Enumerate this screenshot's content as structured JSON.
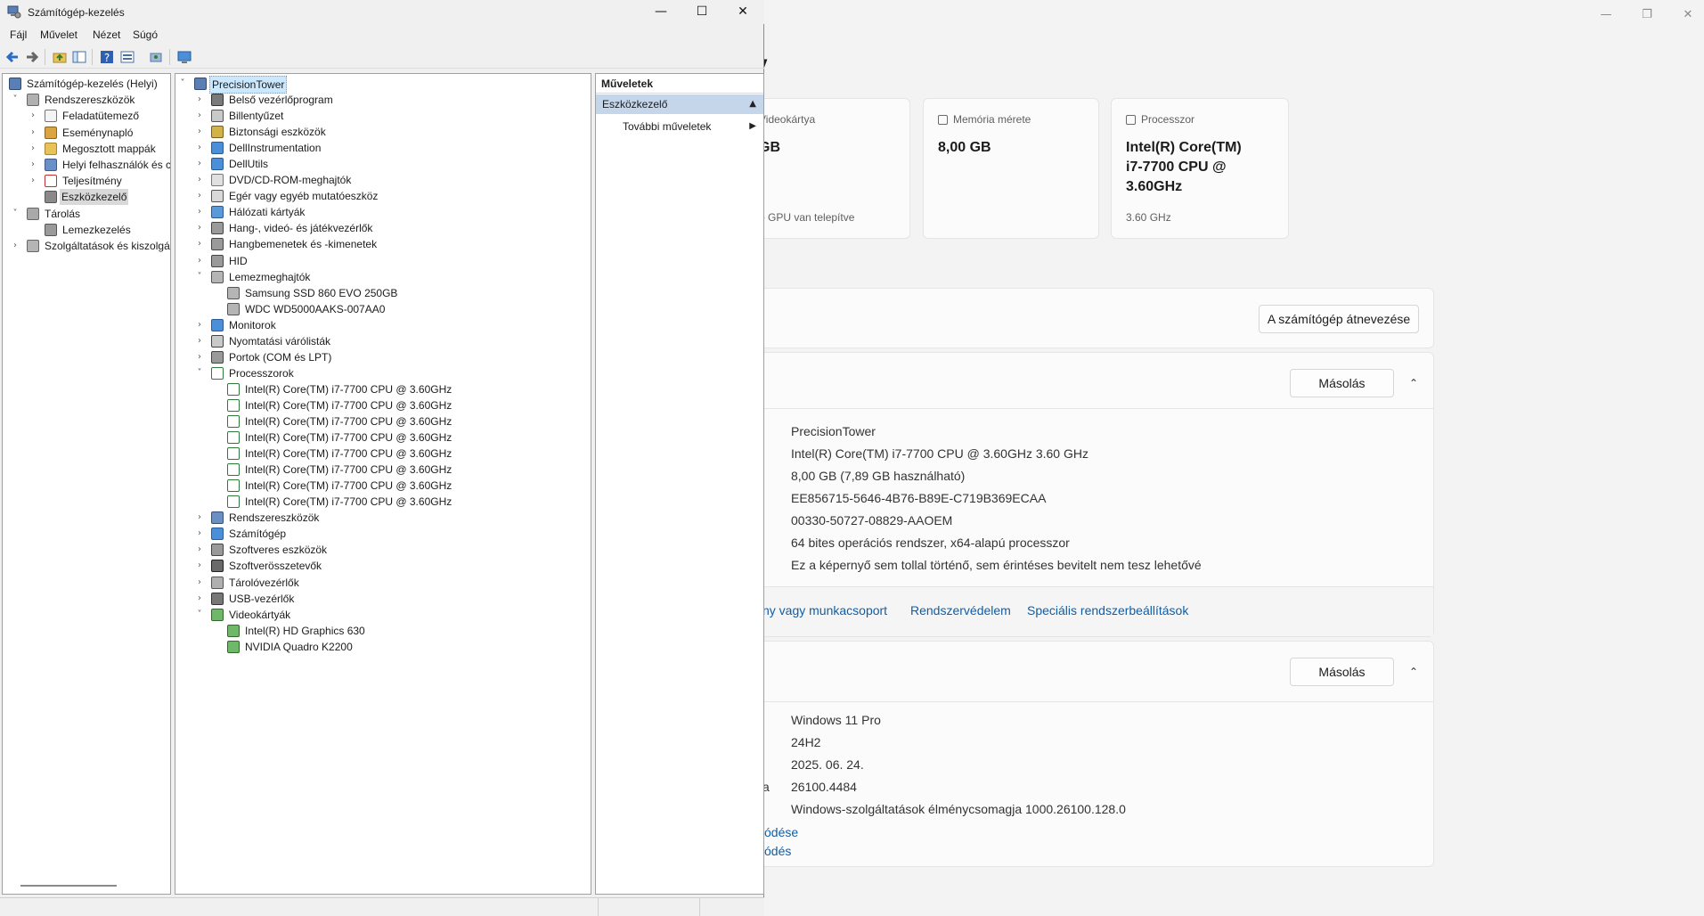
{
  "mmc": {
    "title": "Számítógép-kezelés",
    "window_controls": {
      "minimize": "—",
      "maximize": "☐",
      "close": "✕"
    },
    "menu": [
      "Fájl",
      "Művelet",
      "Nézet",
      "Súgó"
    ],
    "left_tree": [
      {
        "label": "Számítógép-kezelés (Helyi)",
        "icon": "computer-management-icon",
        "expander": ""
      },
      {
        "label": "Rendszereszközök",
        "icon": "tools-icon",
        "expander": "˅"
      },
      {
        "label": "Feladatütemező",
        "icon": "clock-icon",
        "expander": "›"
      },
      {
        "label": "Eseménynapló",
        "icon": "event-log-icon",
        "expander": "›"
      },
      {
        "label": "Megosztott mappák",
        "icon": "shared-folder-icon",
        "expander": "›"
      },
      {
        "label": "Helyi felhasználók és cs",
        "icon": "users-icon",
        "expander": "›"
      },
      {
        "label": "Teljesítmény",
        "icon": "performance-icon",
        "expander": "›"
      },
      {
        "label": "Eszközkezelő",
        "icon": "device-manager-icon",
        "expander": ""
      },
      {
        "label": "Tárolás",
        "icon": "storage-icon",
        "expander": "˅"
      },
      {
        "label": "Lemezkezelés",
        "icon": "disk-management-icon",
        "expander": ""
      },
      {
        "label": "Szolgáltatások és kiszolgáló",
        "icon": "services-icon",
        "expander": "›"
      }
    ],
    "device_tree": {
      "root": "PrecisionTower",
      "items": [
        {
          "label": "Belső vezérlőprogram",
          "icon": "firmware-icon",
          "expander": "›",
          "level": 1
        },
        {
          "label": "Billentyűzet",
          "icon": "keyboard-icon",
          "expander": "›",
          "level": 1
        },
        {
          "label": "Biztonsági eszközök",
          "icon": "security-device-icon",
          "expander": "›",
          "level": 1
        },
        {
          "label": "DellInstrumentation",
          "icon": "monitor-icon",
          "expander": "›",
          "level": 1
        },
        {
          "label": "DellUtils",
          "icon": "monitor-icon",
          "expander": "›",
          "level": 1
        },
        {
          "label": "DVD/CD-ROM-meghajtók",
          "icon": "dvd-icon",
          "expander": "›",
          "level": 1
        },
        {
          "label": "Egér vagy egyéb mutatóeszköz",
          "icon": "mouse-icon",
          "expander": "›",
          "level": 1
        },
        {
          "label": "Hálózati kártyák",
          "icon": "network-icon",
          "expander": "›",
          "level": 1
        },
        {
          "label": "Hang-, videó- és játékvezérlők",
          "icon": "speaker-icon",
          "expander": "›",
          "level": 1
        },
        {
          "label": "Hangbemenetek és -kimenetek",
          "icon": "speaker-icon",
          "expander": "›",
          "level": 1
        },
        {
          "label": "HID",
          "icon": "hid-icon",
          "expander": "›",
          "level": 1
        },
        {
          "label": "Lemezmeghajtók",
          "icon": "disk-drive-icon",
          "expander": "˅",
          "level": 1
        },
        {
          "label": "Samsung SSD 860 EVO 250GB",
          "icon": "disk-drive-icon",
          "expander": "",
          "level": 2
        },
        {
          "label": "WDC WD5000AAKS-007AA0",
          "icon": "disk-drive-icon",
          "expander": "",
          "level": 2
        },
        {
          "label": "Monitorok",
          "icon": "monitor-icon",
          "expander": "›",
          "level": 1
        },
        {
          "label": "Nyomtatási várólisták",
          "icon": "printer-icon",
          "expander": "›",
          "level": 1
        },
        {
          "label": "Portok (COM és LPT)",
          "icon": "port-icon",
          "expander": "›",
          "level": 1
        },
        {
          "label": "Processzorok",
          "icon": "processor-icon",
          "expander": "˅",
          "level": 1
        },
        {
          "label": "Intel(R) Core(TM) i7-7700 CPU @ 3.60GHz",
          "icon": "processor-icon",
          "expander": "",
          "level": 2
        },
        {
          "label": "Intel(R) Core(TM) i7-7700 CPU @ 3.60GHz",
          "icon": "processor-icon",
          "expander": "",
          "level": 2
        },
        {
          "label": "Intel(R) Core(TM) i7-7700 CPU @ 3.60GHz",
          "icon": "processor-icon",
          "expander": "",
          "level": 2
        },
        {
          "label": "Intel(R) Core(TM) i7-7700 CPU @ 3.60GHz",
          "icon": "processor-icon",
          "expander": "",
          "level": 2
        },
        {
          "label": "Intel(R) Core(TM) i7-7700 CPU @ 3.60GHz",
          "icon": "processor-icon",
          "expander": "",
          "level": 2
        },
        {
          "label": "Intel(R) Core(TM) i7-7700 CPU @ 3.60GHz",
          "icon": "processor-icon",
          "expander": "",
          "level": 2
        },
        {
          "label": "Intel(R) Core(TM) i7-7700 CPU @ 3.60GHz",
          "icon": "processor-icon",
          "expander": "",
          "level": 2
        },
        {
          "label": "Intel(R) Core(TM) i7-7700 CPU @ 3.60GHz",
          "icon": "processor-icon",
          "expander": "",
          "level": 2
        },
        {
          "label": "Rendszereszközök",
          "icon": "system-device-icon",
          "expander": "›",
          "level": 1
        },
        {
          "label": "Számítógép",
          "icon": "monitor-icon",
          "expander": "›",
          "level": 1
        },
        {
          "label": "Szoftveres eszközök",
          "icon": "software-device-icon",
          "expander": "›",
          "level": 1
        },
        {
          "label": "Szoftverösszetevők",
          "icon": "software-component-icon",
          "expander": "›",
          "level": 1
        },
        {
          "label": "Tárolóvezérlők",
          "icon": "storage-controller-icon",
          "expander": "›",
          "level": 1
        },
        {
          "label": "USB-vezérlők",
          "icon": "usb-icon",
          "expander": "›",
          "level": 1
        },
        {
          "label": "Videokártyák",
          "icon": "display-adapter-icon",
          "expander": "˅",
          "level": 1
        },
        {
          "label": "Intel(R) HD Graphics 630",
          "icon": "display-adapter-icon",
          "expander": "",
          "level": 2
        },
        {
          "label": "NVIDIA Quadro K2200",
          "icon": "display-adapter-icon",
          "expander": "",
          "level": 2
        }
      ]
    },
    "actions": {
      "header": "Műveletek",
      "section": "Eszközkezelő",
      "section_arrow": "▲",
      "more": "További műveletek",
      "more_arrow": "▶"
    }
  },
  "settings": {
    "title_fragment": "y",
    "window_controls": {
      "minimize": "—",
      "maximize": "❐",
      "close": "✕"
    },
    "cards": [
      {
        "header": "Videokártya",
        "value": "GB",
        "sub": "b GPU van telepítve",
        "icon": "gpu-icon"
      },
      {
        "header": "Memória mérete",
        "value": "8,00 GB",
        "sub": "",
        "icon": "memory-icon"
      },
      {
        "header": "Processzor",
        "value": "Intel(R) Core(TM) i7-7700 CPU @ 3.60GHz",
        "sub": "3.60 GHz",
        "icon": "processor-icon"
      }
    ],
    "rename_button": "A számítógép átnevezése",
    "copy_button": "Másolás",
    "chevron_up": "⌃",
    "device_specs": [
      "PrecisionTower",
      "Intel(R) Core(TM) i7-7700 CPU @ 3.60GHz   3.60 GHz",
      "8,00 GB (7,89 GB használható)",
      "EE856715-5646-4B76-B89E-C719B369ECAA",
      "00330-50727-08829-AAOEM",
      "64 bites operációs rendszer, x64-alapú processzor",
      "Ez a képernyő sem tollal történő, sem érintéses bevitelt nem tesz lehetővé"
    ],
    "links": [
      "ny vagy munkacsoport",
      "Rendszervédelem",
      "Speciális rendszerbeállítások"
    ],
    "windows_specs": {
      "label_fragment": "a",
      "values": [
        "Windows 11 Pro",
        "24H2",
        "2025. 06. 24.",
        "26100.4484",
        "Windows-szolgáltatások élménycsomagja 1000.26100.128.0"
      ]
    },
    "bottom_links": [
      "ódése",
      "ódés"
    ]
  },
  "colors": {
    "selection": "#cce8ff",
    "link": "#0f5ea8",
    "actions_header": "#c5d6ea"
  }
}
